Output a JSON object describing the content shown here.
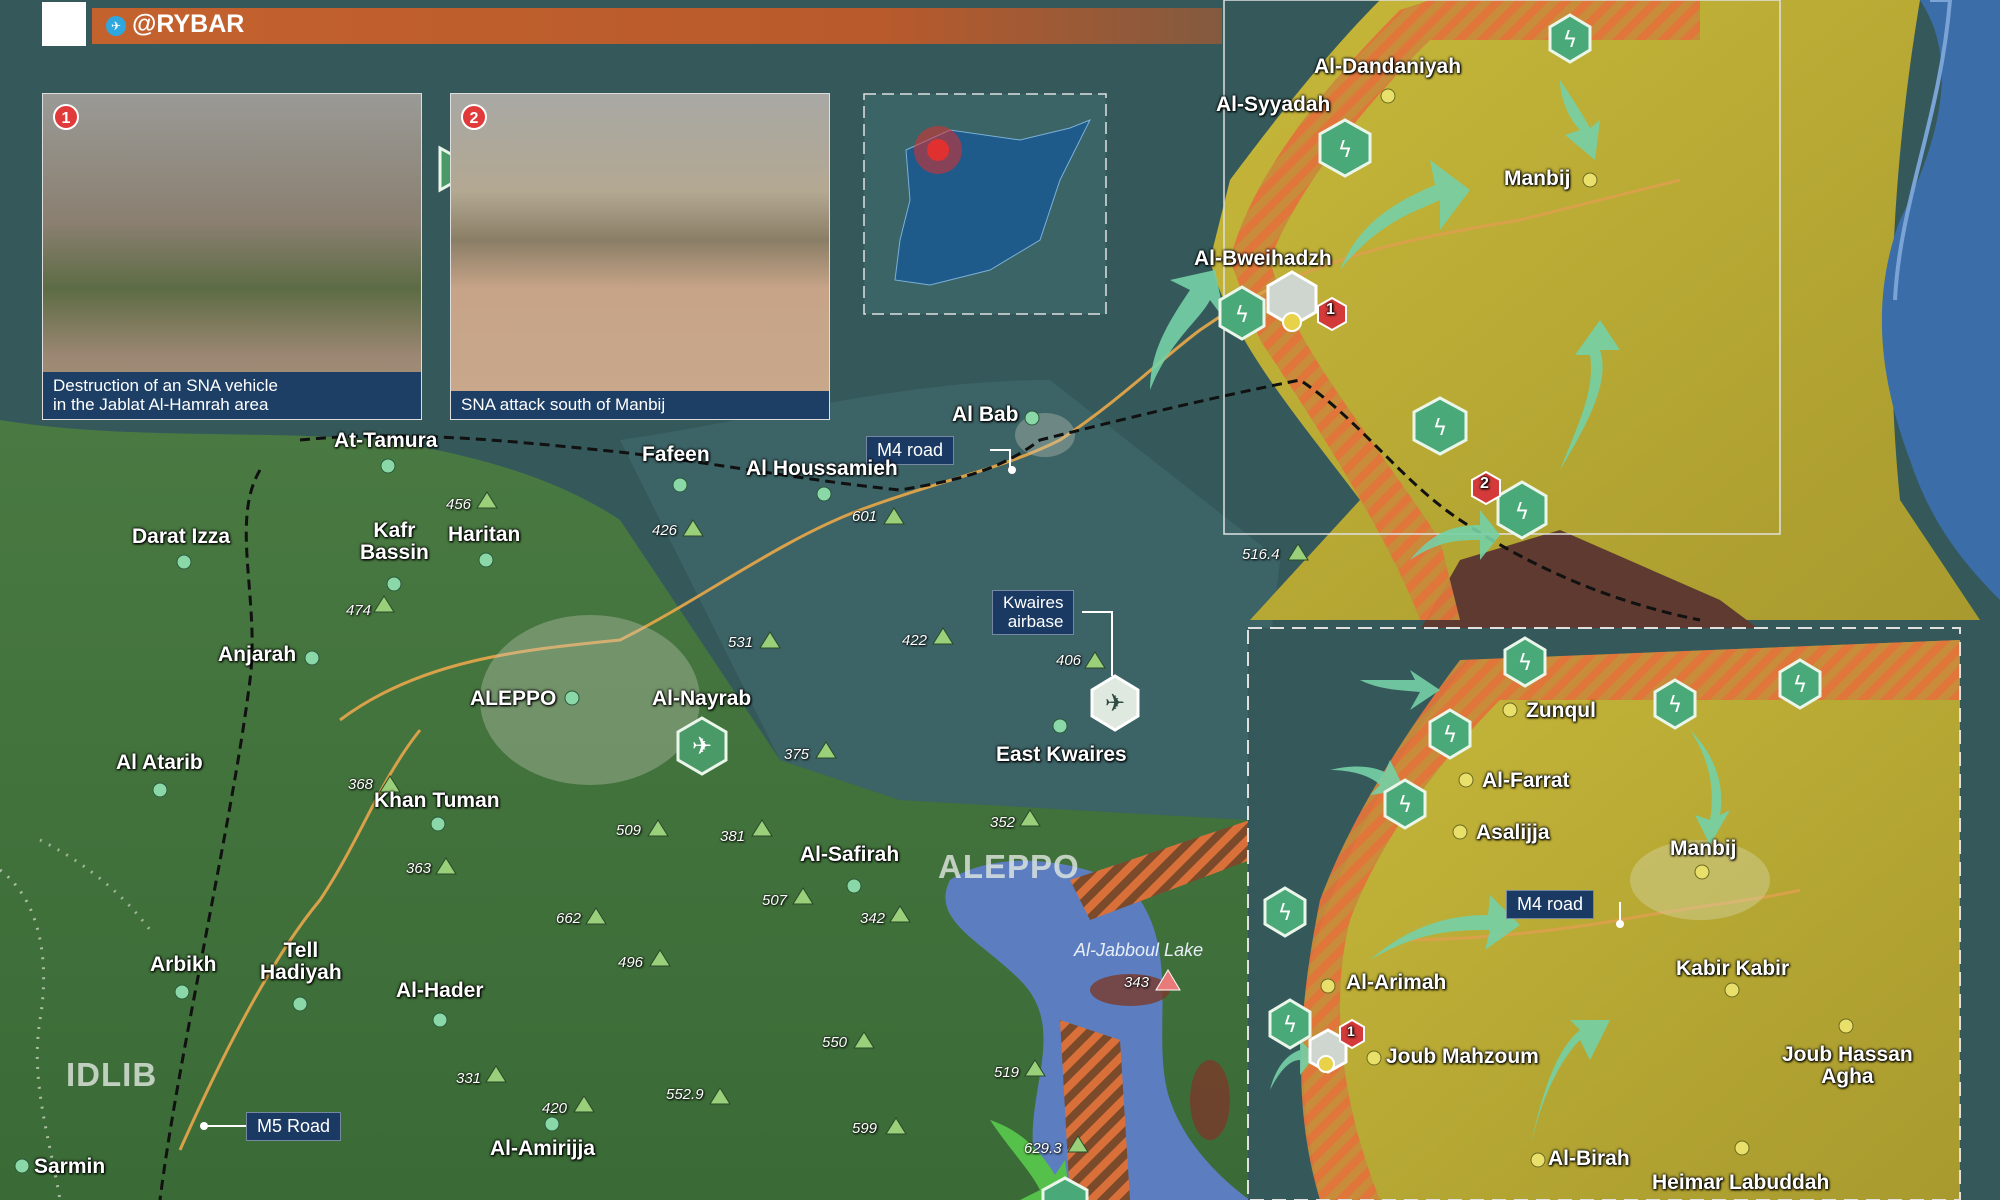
{
  "header": {
    "brand": "@RYBAR"
  },
  "photos": [
    {
      "number": "1",
      "caption_line1": "Destruction of an SNA vehicle",
      "caption_line2": "in the Jablat Al-Hamrah area"
    },
    {
      "number": "2",
      "caption_line1": "SNA attack south of Manbij"
    }
  ],
  "regions": {
    "idlib": "IDLIB",
    "aleppo": "ALEPPO"
  },
  "lake": "Al-Jabboul Lake",
  "roads": {
    "m4_main": "M4 road",
    "m4_inset": "M4 road",
    "m5": "M5 Road"
  },
  "airbase": {
    "line1": "Kwaires",
    "line2": "airbase"
  },
  "settlements_main": {
    "at_tamura": "At-Tamura",
    "fafeen": "Fafeen",
    "al_houssamieh": "Al Houssamieh",
    "al_bab": "Al Bab",
    "darat_izza": "Darat Izza",
    "kafr_bassin_1": "Kafr",
    "kafr_bassin_2": "Bassin",
    "haritan": "Haritan",
    "anjarah": "Anjarah",
    "aleppo": "ALEPPO",
    "al_nayrab": "Al-Nayrab",
    "al_atarib": "Al Atarib",
    "khan_tuman": "Khan Tuman",
    "east_kwaires": "East Kwaires",
    "al_safirah": "Al-Safirah",
    "arbikh": "Arbikh",
    "tell_hadiyah_1": "Tell",
    "tell_hadiyah_2": "Hadiyah",
    "al_hader": "Al-Hader",
    "al_amirijja": "Al-Amirijja",
    "sarmin": "Sarmin",
    "al_dandaniyah": "Al-Dandaniyah",
    "al_syyadah": "Al-Syyadah",
    "manbij": "Manbij",
    "al_bweihadzh": "Al-Bweihadzh"
  },
  "settlements_inset": {
    "zunqul": "Zunqul",
    "al_farrat": "Al-Farrat",
    "asalijja": "Asalijja",
    "manbij": "Manbij",
    "al_arimah": "Al-Arimah",
    "kabir_kabir": "Kabir Kabir",
    "joub_mahzoum": "Joub Mahzoum",
    "joub_hassan_1": "Joub Hassan",
    "joub_hassan_2": "Agha",
    "al_birah": "Al-Birah",
    "heimar": "Heimar Labuddah"
  },
  "markers": {
    "event_1": "1",
    "event_2": "2",
    "inset_event_1": "1"
  },
  "elevations": {
    "e456": "456",
    "e426": "426",
    "e601": "601",
    "e474": "474",
    "e531": "531",
    "e422": "422",
    "e406": "406",
    "e368": "368",
    "e375": "375",
    "e509": "509",
    "e381": "381",
    "e363": "363",
    "e352": "352",
    "e507": "507",
    "e342": "342",
    "e662": "662",
    "e496": "496",
    "e343": "343",
    "e550": "550",
    "e331": "331",
    "e519": "519",
    "e420": "420",
    "e5529": "552.9",
    "e599": "599",
    "e6293": "629.3",
    "e5164": "516.4"
  },
  "colors": {
    "sna_zone": "#c9bd3a",
    "government_zone": "#3e7a3e",
    "turkish_zone": "#3a6b6e",
    "frontline": "#e0753a",
    "advance_arrow": "#6ec9a0"
  }
}
